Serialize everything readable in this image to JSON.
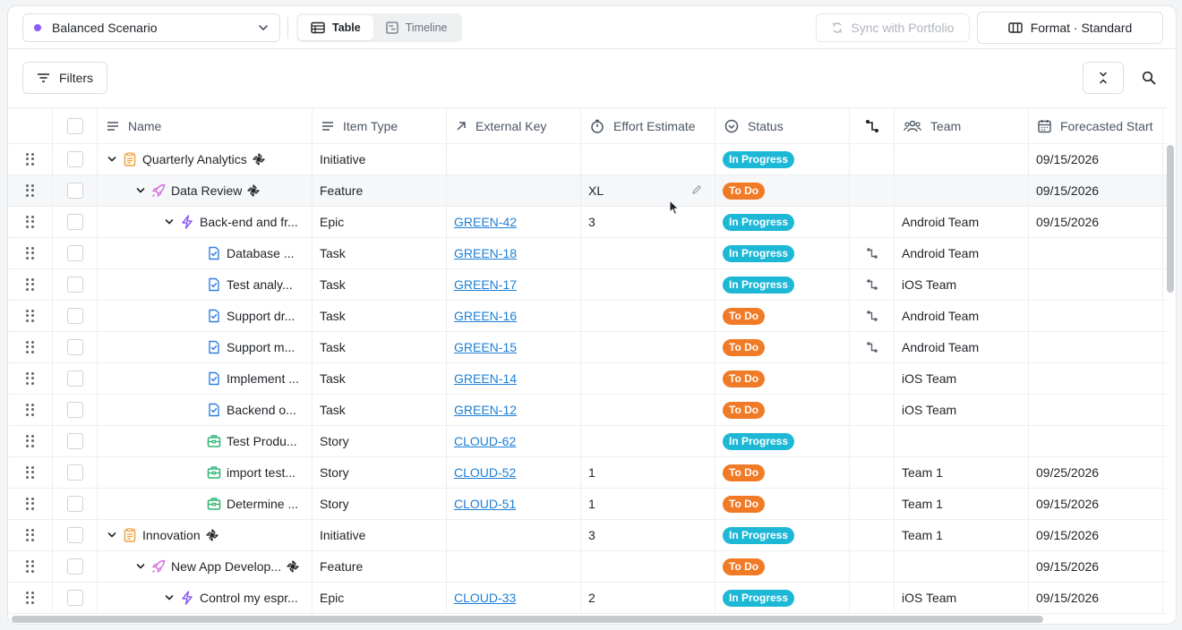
{
  "toolbar": {
    "scenario": "Balanced Scenario",
    "scenario_color": "#8b5cf6",
    "view_tabs": [
      {
        "label": "Table",
        "icon": "table-icon",
        "active": true
      },
      {
        "label": "Timeline",
        "icon": "timeline-icon",
        "active": false
      }
    ],
    "sync_label": "Sync with Portfolio",
    "format_label": "Format · Standard"
  },
  "filters": {
    "label": "Filters"
  },
  "table": {
    "columns": [
      {
        "key": "name",
        "label": "Name",
        "icon": "lines-icon"
      },
      {
        "key": "type",
        "label": "Item Type",
        "icon": "lines-icon"
      },
      {
        "key": "key",
        "label": "External Key",
        "icon": "arrow-up-right-icon"
      },
      {
        "key": "effort",
        "label": "Effort Estimate",
        "icon": "stopwatch-icon"
      },
      {
        "key": "status",
        "label": "Status",
        "icon": "chevron-circle-icon"
      },
      {
        "key": "dependency",
        "label": "",
        "icon": "dependency-icon"
      },
      {
        "key": "team",
        "label": "Team",
        "icon": "people-icon"
      },
      {
        "key": "start",
        "label": "Forecasted Start",
        "icon": "calendar-icon"
      }
    ],
    "rows": [
      {
        "level": 0,
        "expander": true,
        "icon": "initiative-icon",
        "name": "Quarterly Analytics",
        "flag": true,
        "type": "Initiative",
        "key": "",
        "effort": "",
        "status": "In Progress",
        "dep": false,
        "team": "",
        "start": "09/15/2026"
      },
      {
        "level": 1,
        "expander": true,
        "icon": "feature-icon",
        "name": "Data Review",
        "flag": true,
        "type": "Feature",
        "key": "",
        "effort": "XL",
        "status": "To Do",
        "dep": false,
        "team": "",
        "start": "09/15/2026",
        "highlight": true,
        "editing": true
      },
      {
        "level": 2,
        "expander": true,
        "icon": "epic-icon",
        "name": "Back-end and fr...",
        "flag": false,
        "type": "Epic",
        "key": "GREEN-42",
        "effort": "3",
        "status": "In Progress",
        "dep": false,
        "team": "Android Team",
        "start": "09/15/2026"
      },
      {
        "level": 3,
        "expander": false,
        "icon": "task-icon",
        "name": "Database ...",
        "flag": false,
        "type": "Task",
        "key": "GREEN-18",
        "effort": "",
        "status": "In Progress",
        "dep": true,
        "team": "Android Team",
        "start": ""
      },
      {
        "level": 3,
        "expander": false,
        "icon": "task-icon",
        "name": "Test analy...",
        "flag": false,
        "type": "Task",
        "key": "GREEN-17",
        "effort": "",
        "status": "In Progress",
        "dep": true,
        "team": "iOS Team",
        "start": ""
      },
      {
        "level": 3,
        "expander": false,
        "icon": "task-icon",
        "name": "Support dr...",
        "flag": false,
        "type": "Task",
        "key": "GREEN-16",
        "effort": "",
        "status": "To Do",
        "dep": true,
        "team": "Android Team",
        "start": ""
      },
      {
        "level": 3,
        "expander": false,
        "icon": "task-icon",
        "name": "Support m...",
        "flag": false,
        "type": "Task",
        "key": "GREEN-15",
        "effort": "",
        "status": "To Do",
        "dep": true,
        "team": "Android Team",
        "start": ""
      },
      {
        "level": 3,
        "expander": false,
        "icon": "task-icon",
        "name": "Implement ...",
        "flag": false,
        "type": "Task",
        "key": "GREEN-14",
        "effort": "",
        "status": "To Do",
        "dep": false,
        "team": "iOS Team",
        "start": ""
      },
      {
        "level": 3,
        "expander": false,
        "icon": "task-icon",
        "name": "Backend o...",
        "flag": false,
        "type": "Task",
        "key": "GREEN-12",
        "effort": "",
        "status": "To Do",
        "dep": false,
        "team": "iOS Team",
        "start": ""
      },
      {
        "level": 3,
        "expander": false,
        "icon": "story-icon",
        "name": "Test Produ...",
        "flag": false,
        "type": "Story",
        "key": "CLOUD-62",
        "effort": "",
        "status": "In Progress",
        "dep": false,
        "team": "",
        "start": ""
      },
      {
        "level": 3,
        "expander": false,
        "icon": "story-icon",
        "name": "import test...",
        "flag": false,
        "type": "Story",
        "key": "CLOUD-52",
        "effort": "1",
        "status": "To Do",
        "dep": false,
        "team": "Team 1",
        "start": "09/25/2026"
      },
      {
        "level": 3,
        "expander": false,
        "icon": "story-icon",
        "name": "Determine ...",
        "flag": false,
        "type": "Story",
        "key": "CLOUD-51",
        "effort": "1",
        "status": "To Do",
        "dep": false,
        "team": "Team 1",
        "start": "09/15/2026"
      },
      {
        "level": 0,
        "expander": true,
        "icon": "initiative-icon",
        "name": "Innovation",
        "flag": true,
        "type": "Initiative",
        "key": "",
        "effort": "3",
        "status": "In Progress",
        "dep": false,
        "team": "Team 1",
        "start": "09/15/2026"
      },
      {
        "level": 1,
        "expander": true,
        "icon": "feature-icon",
        "name": "New App Develop...",
        "flag": true,
        "type": "Feature",
        "key": "",
        "effort": "",
        "status": "To Do",
        "dep": false,
        "team": "",
        "start": "09/15/2026"
      },
      {
        "level": 2,
        "expander": true,
        "icon": "epic-icon",
        "name": "Control my espr...",
        "flag": false,
        "type": "Epic",
        "key": "CLOUD-33",
        "effort": "2",
        "status": "In Progress",
        "dep": false,
        "team": "iOS Team",
        "start": "09/15/2026"
      }
    ]
  },
  "colors": {
    "in_progress": "#1cb8d6",
    "to_do": "#f07a26",
    "link": "#1d7fd6",
    "initiative": "#f0a040",
    "feature": "#d26be0",
    "epic": "#8b5cf6",
    "task": "#2f7fe0",
    "story": "#2bb673"
  }
}
